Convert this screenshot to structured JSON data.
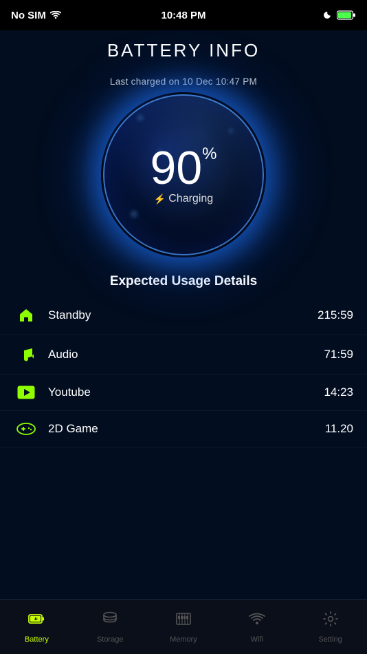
{
  "statusBar": {
    "carrier": "No SIM",
    "time": "10:48 PM"
  },
  "header": {
    "title": "BATTERY INFO"
  },
  "battery": {
    "lastCharged": "Last charged on 10 Dec 10:47 PM",
    "percent": "90",
    "percentSymbol": "%",
    "chargingLabel": "Charging"
  },
  "usageSection": {
    "title": "Expected Usage Details"
  },
  "usageItems": [
    {
      "icon": "home",
      "name": "Standby",
      "value": "215:59"
    },
    {
      "icon": "music",
      "name": "Audio",
      "value": "71:59"
    },
    {
      "icon": "play",
      "name": "Youtube",
      "value": "14:23"
    },
    {
      "icon": "gamepad",
      "name": "2D Game",
      "value": "11.20"
    }
  ],
  "tabBar": {
    "items": [
      {
        "id": "battery",
        "label": "Battery",
        "active": true
      },
      {
        "id": "storage",
        "label": "Storage",
        "active": false
      },
      {
        "id": "memory",
        "label": "Memory",
        "active": false
      },
      {
        "id": "wifi",
        "label": "Wifi",
        "active": false
      },
      {
        "id": "setting",
        "label": "Setting",
        "active": false
      }
    ]
  }
}
